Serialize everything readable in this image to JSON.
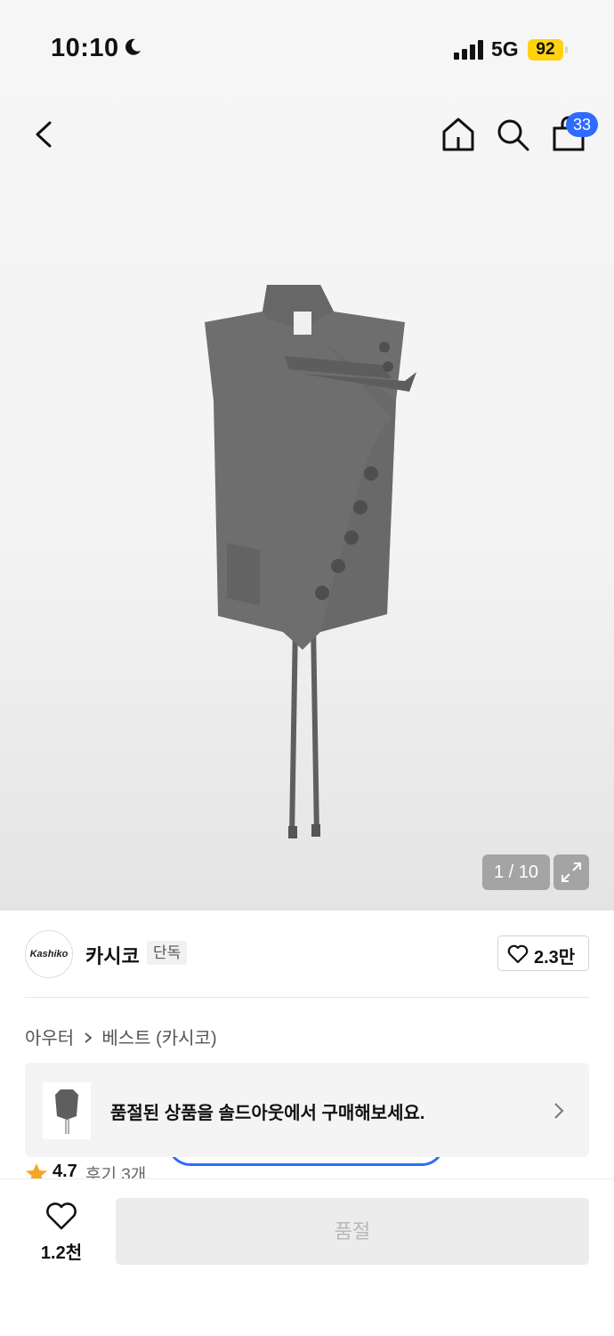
{
  "status_bar": {
    "time": "10:10",
    "network": "5G",
    "battery": "92",
    "battery_color": "#ffd30f"
  },
  "header": {
    "icons": [
      "back-icon",
      "home-icon",
      "search-icon",
      "shopping-bag-icon"
    ],
    "cart_count": "33",
    "accent_color": "#2f6bff"
  },
  "gallery": {
    "image_subject": "gray asymmetric button vest with bow ties",
    "counter": "1 / 10"
  },
  "brand": {
    "name": "카시코",
    "logo_text": "Kashiko",
    "badge": "단독",
    "likes": "2.3만"
  },
  "breadcrumb": {
    "items": [
      "아우터",
      "베스트 (카시코)"
    ]
  },
  "soldout_banner": {
    "text": "품절된 상품을 솔드아웃에서 구매해보세요."
  },
  "rating": {
    "score": "4.7",
    "reviews": "후기 3개"
  },
  "bottom_bar": {
    "wish_count": "1.2천",
    "buy_label": "품절"
  }
}
